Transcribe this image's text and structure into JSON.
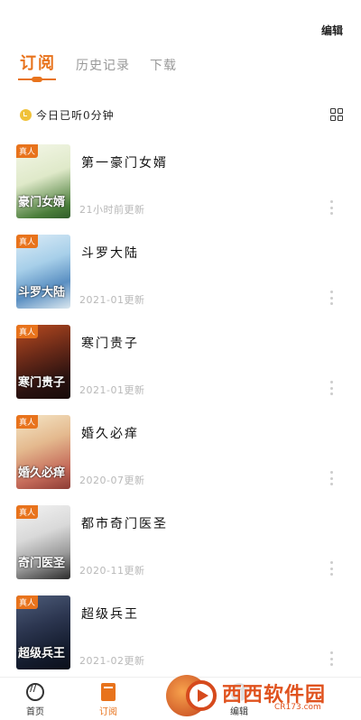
{
  "header": {
    "edit_label": "编辑"
  },
  "tabs": [
    {
      "label": "订阅",
      "active": true
    },
    {
      "label": "历史记录",
      "active": false
    },
    {
      "label": "下载",
      "active": false
    }
  ],
  "listen_summary": "今日已听0分钟",
  "badge_label": "真人",
  "books": [
    {
      "title": "第一豪门女婿",
      "updated": "21小时前更新",
      "cover_text": "豪门女婿"
    },
    {
      "title": "斗罗大陆",
      "updated": "2021-01更新",
      "cover_text": "斗罗大陆"
    },
    {
      "title": "寒门贵子",
      "updated": "2021-01更新",
      "cover_text": "寒门贵子"
    },
    {
      "title": "婚久必痒",
      "updated": "2020-07更新",
      "cover_text": "婚久必痒"
    },
    {
      "title": "都市奇门医圣",
      "updated": "2020-11更新",
      "cover_text": "奇门医圣"
    },
    {
      "title": "超级兵王",
      "updated": "2021-02更新",
      "cover_text": "超级兵王"
    }
  ],
  "bottom_nav": [
    {
      "label": "首页",
      "active": false
    },
    {
      "label": "订阅",
      "active": true
    },
    {
      "label": "编辑",
      "active": false
    }
  ],
  "watermark": {
    "text": "西西软件园",
    "sub": "CR173.com"
  },
  "colors": {
    "accent": "#e8731c"
  }
}
